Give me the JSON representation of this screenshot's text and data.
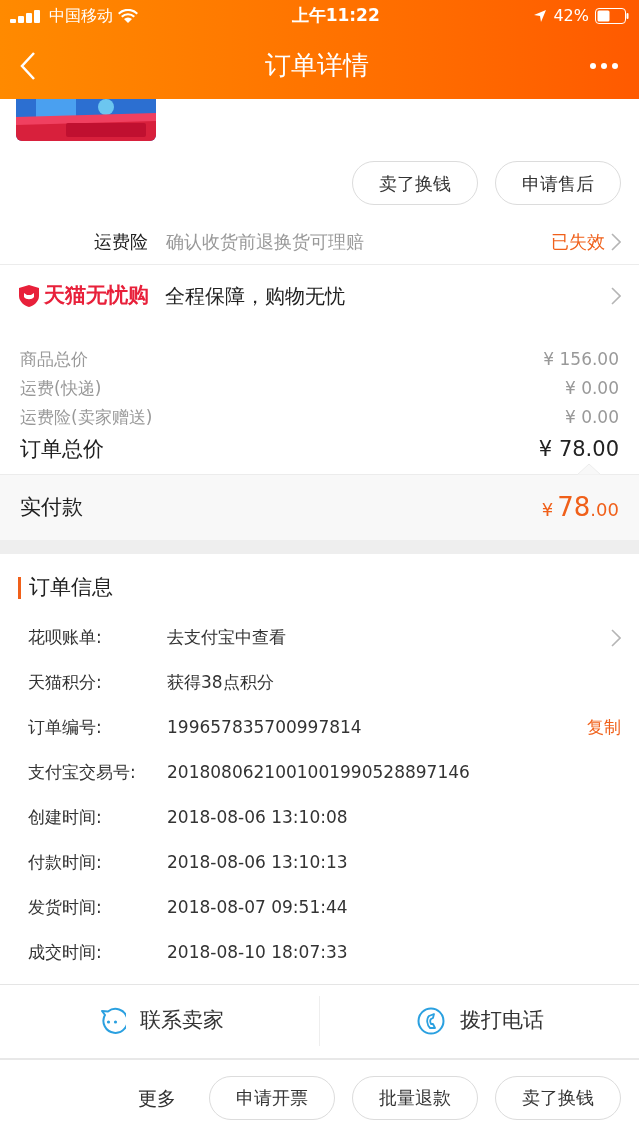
{
  "status_bar": {
    "carrier": "中国移动",
    "time": "上午11:22",
    "battery": "42%"
  },
  "header": {
    "title": "订单详情"
  },
  "product": {
    "kind": "picture"
  },
  "top_buttons": [
    "卖了换钱",
    "申请售后"
  ],
  "freight_insurance": {
    "label": "运费险",
    "description": "确认收货前退换货可理赔",
    "status": "已失效"
  },
  "guarantee": {
    "brand": "天猫无忧购",
    "text": "全程保障，购物无忧"
  },
  "price_lines": [
    {
      "kind": "minor",
      "label": "商品总价",
      "value": "¥ 156.00"
    },
    {
      "kind": "minor",
      "label": "运费(快递)",
      "value": "¥ 0.00"
    },
    {
      "kind": "minor",
      "label": "运费险(卖家赠送)",
      "value": "¥ 0.00"
    },
    {
      "kind": "total",
      "label": "订单总价",
      "value": "¥ 78.00"
    }
  ],
  "paid": {
    "label": "实付款",
    "currency": "¥",
    "integer": "78",
    "decimal": ".00"
  },
  "order_info": {
    "title": "订单信息",
    "rows": [
      {
        "label": "花呗账单:",
        "value": "去支付宝中查看",
        "chevron": true
      },
      {
        "label": "天猫积分:",
        "value": "获得38点积分",
        "chevron": false
      },
      {
        "label": "订单编号:",
        "value": "199657835700997814",
        "chevron": false,
        "action": "复制"
      },
      {
        "label": "支付宝交易号:",
        "value": "2018080621001001990528897146",
        "chevron": false
      },
      {
        "label": "创建时间:",
        "value": "2018-08-06 13:10:08",
        "chevron": false
      },
      {
        "label": "付款时间:",
        "value": "2018-08-06 13:10:13",
        "chevron": false
      },
      {
        "label": "发货时间:",
        "value": "2018-08-07 09:51:44",
        "chevron": false
      },
      {
        "label": "成交时间:",
        "value": "2018-08-10 18:07:33",
        "chevron": false
      }
    ]
  },
  "contact_actions": [
    {
      "kind": "chat",
      "label": "联系卖家"
    },
    {
      "kind": "phone",
      "label": "拨打电话"
    }
  ],
  "more": {
    "label": "更多",
    "buttons": [
      "申请开票",
      "批量退款",
      "卖了换钱"
    ]
  }
}
